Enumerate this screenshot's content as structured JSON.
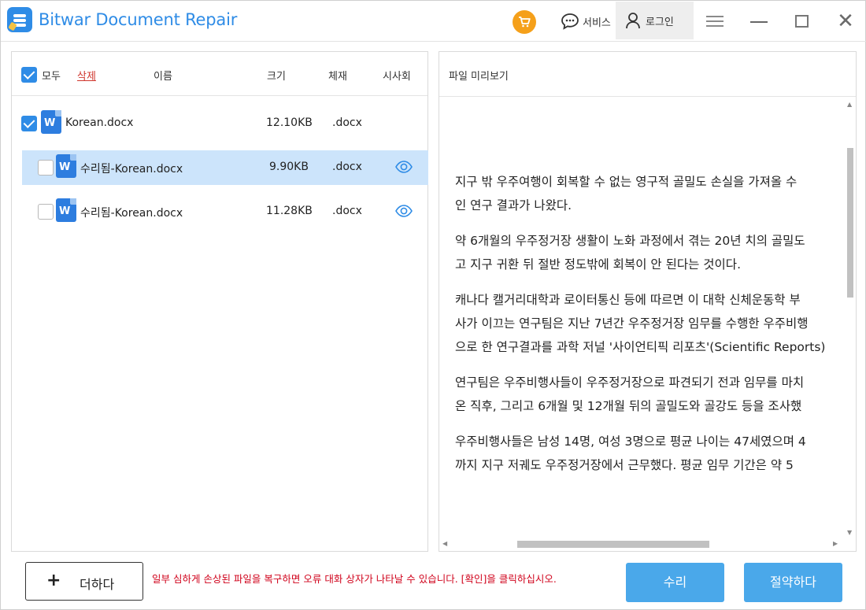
{
  "app": {
    "title": "Bitwar Document Repair",
    "service_label": "서비스",
    "login_label": "로그인",
    "accent_color": "#2f8ce6"
  },
  "file_list": {
    "header": {
      "select_all_label": "모두",
      "delete_label": "삭제",
      "col_name": "이름",
      "col_size": "크기",
      "col_format": "체재",
      "col_preview": "시사회"
    },
    "rows": [
      {
        "name": "Korean.docx",
        "size": "12.10KB",
        "format": ".docx",
        "checked": true,
        "selected": false,
        "icon": "word-icon",
        "has_preview": false
      },
      {
        "name": "수리됨-Korean.docx",
        "size": "9.90KB",
        "format": ".docx",
        "checked": false,
        "selected": true,
        "icon": "word-icon",
        "has_preview": true
      },
      {
        "name": "수리됨-Korean.docx",
        "size": "11.28KB",
        "format": ".docx",
        "checked": false,
        "selected": false,
        "icon": "word-icon",
        "has_preview": true
      }
    ]
  },
  "preview": {
    "title": "파일 미리보기",
    "paragraphs": [
      [
        "지구 밖 우주여행이 회복할 수 없는 영구적 골밀도 손실을 가져올 수",
        "인 연구 결과가 나왔다."
      ],
      [
        "약 6개월의 우주정거장 생활이 노화 과정에서 겪는 20년 치의 골밀도",
        "고 지구 귀환 뒤 절반 정도밖에 회복이 안 된다는 것이다."
      ],
      [
        "캐나다 캘거리대학과 로이터통신 등에 따르면 이 대학 신체운동학 부",
        "사가 이끄는 연구팀은 지난 7년간 우주정거장 임무를 수행한 우주비행",
        "으로 한 연구결과를 과학 저널 '사이언티픽 리포츠'(Scientific Reports)"
      ],
      [
        "연구팀은 우주비행사들이 우주정거장으로 파견되기 전과 임무를 마치",
        "온 직후, 그리고 6개월 및 12개월 뒤의 골밀도와 골강도 등을 조사했"
      ],
      [
        "우주비행사들은 남성 14명, 여성 3명으로 평균 나이는 47세였으며 4",
        "까지 지구 저궤도 우주정거장에서 근무했다. 평균 임무 기간은 약 5"
      ]
    ]
  },
  "footer": {
    "add_label": "더하다",
    "warning": "일부 심하게 손상된 파일을 복구하면 오류 대화 상자가 나타날 수 있습니다. [확인]을 클릭하십시오.",
    "repair_label": "수리",
    "save_label": "절약하다",
    "button_color": "#4aa8ea",
    "warning_color": "#d0021b"
  }
}
